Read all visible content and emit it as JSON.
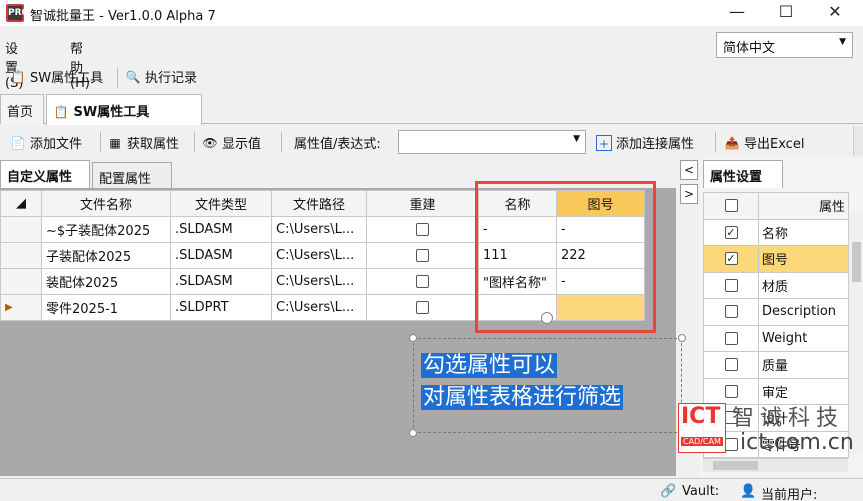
{
  "window": {
    "title": "智诚批量王 - Ver1.0.0 Alpha 7",
    "icon_label": "PRO",
    "minimize": "—",
    "maximize": "☐",
    "close": "✕"
  },
  "menu": [
    "设置(S)",
    "帮助(H)"
  ],
  "language": {
    "selected": "简体中文"
  },
  "toolbar1": [
    "SW属性工具",
    "执行记录"
  ],
  "tabs": [
    {
      "label": "首页",
      "active": false
    },
    {
      "label": "SW属性工具",
      "active": true
    }
  ],
  "toolbar2": {
    "add_file": "添加文件",
    "get_props": "获取属性",
    "show_value": "显示值",
    "expr_label": "属性值/表达式:",
    "expr_value": "",
    "add_link_prop": "添加连接属性",
    "export_excel": "导出Excel"
  },
  "subtabs": [
    {
      "label": "自定义属性",
      "active": true
    },
    {
      "label": "配置属性",
      "active": false
    }
  ],
  "grid": {
    "columns": [
      "文件名称",
      "文件类型",
      "文件路径",
      "重建",
      "名称",
      "图号"
    ],
    "rows": [
      {
        "marker": "",
        "name": "~$子装配体2025",
        "type": ".SLDASM",
        "path": "C:\\Users\\L...",
        "rebuild": false,
        "prop_name": "-",
        "prop_no": "-"
      },
      {
        "marker": "",
        "name": "子装配体2025",
        "type": ".SLDASM",
        "path": "C:\\Users\\L...",
        "rebuild": false,
        "prop_name": "111",
        "prop_no": "222"
      },
      {
        "marker": "",
        "name": "装配体2025",
        "type": ".SLDASM",
        "path": "C:\\Users\\L...",
        "rebuild": false,
        "prop_name": "\"图样名称\"",
        "prop_no": "-"
      },
      {
        "marker": "▶",
        "name": "零件2025-1",
        "type": ".SLDPRT",
        "path": "C:\\Users\\L...",
        "rebuild": false,
        "prop_name": "",
        "prop_no": ""
      }
    ]
  },
  "callout": {
    "line1": "勾选属性可以",
    "line2": "对属性表格进行筛选"
  },
  "panel": {
    "collapse_left": "<",
    "collapse_right": ">",
    "tab": "属性设置",
    "header": "属性",
    "props": [
      {
        "name": "名称",
        "checked": true
      },
      {
        "name": "图号",
        "checked": true
      },
      {
        "name": "材质",
        "checked": false
      },
      {
        "name": "Description",
        "checked": false
      },
      {
        "name": "Weight",
        "checked": false
      },
      {
        "name": "质量",
        "checked": false
      },
      {
        "name": "审定",
        "checked": false
      },
      {
        "name": "设计",
        "checked": false
      },
      {
        "name": "零件号",
        "checked": false
      }
    ]
  },
  "watermark": {
    "logo": "ICT",
    "logo_sub": "CAD/CAM",
    "cn": "智诚科技",
    "url": "ict.com.cn"
  },
  "status": {
    "vault": "Vault:",
    "user": "当前用户:"
  },
  "colors": {
    "highlight": "#fdd87a",
    "annotation_red": "#e8453c",
    "callout_blue": "#1e6fd1"
  }
}
